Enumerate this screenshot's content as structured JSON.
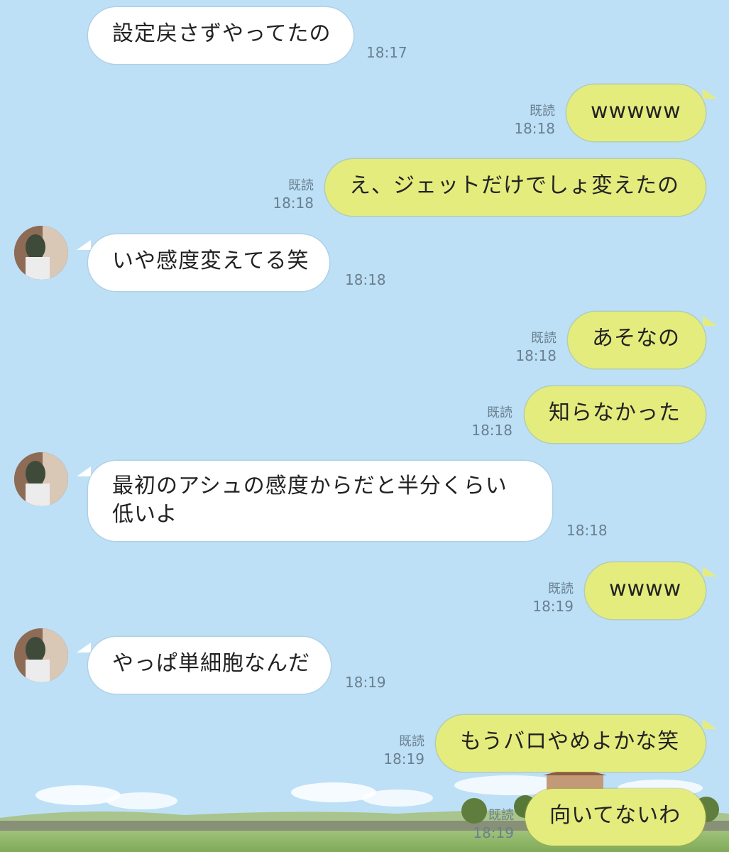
{
  "messages": [
    {
      "side": "in",
      "text": "設定戻さずやってたの",
      "time": "18:17",
      "avatar": false
    },
    {
      "side": "out",
      "text": "wwwww",
      "time": "18:18",
      "read": "既読"
    },
    {
      "side": "out",
      "text": "え、ジェットだけでしょ変えたの",
      "time": "18:18",
      "read": "既読"
    },
    {
      "side": "in",
      "text": "いや感度変えてる笑",
      "time": "18:18",
      "avatar": true
    },
    {
      "side": "out",
      "text": "あそなの",
      "time": "18:18",
      "read": "既読"
    },
    {
      "side": "out",
      "text": "知らなかった",
      "time": "18:18",
      "read": "既読"
    },
    {
      "side": "in",
      "text": "最初のアシュの感度からだと半分くらい低いよ",
      "time": "18:18",
      "avatar": true
    },
    {
      "side": "out",
      "text": "wwww",
      "time": "18:19",
      "read": "既読"
    },
    {
      "side": "in",
      "text": "やっぱ単細胞なんだ",
      "time": "18:19",
      "avatar": true
    },
    {
      "side": "out",
      "text": "もうバロやめよかな笑",
      "time": "18:19",
      "read": "既読"
    },
    {
      "side": "out",
      "text": "向いてないわ",
      "time": "18:19",
      "read": "既読"
    }
  ],
  "colors": {
    "background": "#bde0f7",
    "incoming_bubble": "#ffffff",
    "outgoing_bubble": "#e4ec7e",
    "meta_text": "#6a7f8e"
  },
  "icons": {
    "avatar": "user-avatar-photo"
  }
}
